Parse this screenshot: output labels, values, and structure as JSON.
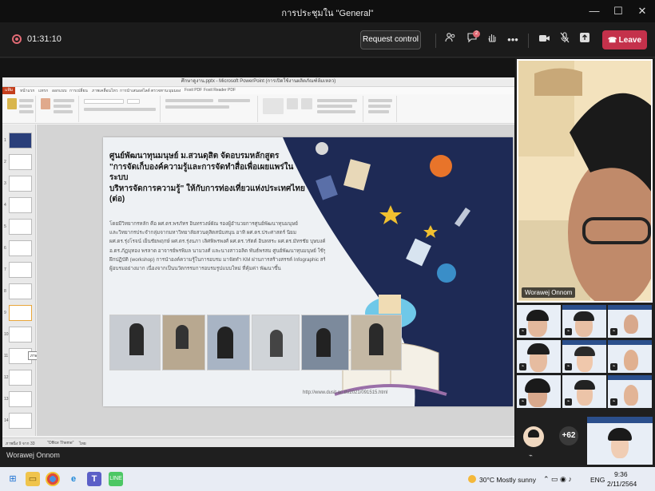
{
  "window": {
    "title": "การประชุมใน \"General\"",
    "minimize": "—",
    "maximize": "☐",
    "close": "✕"
  },
  "toolbar": {
    "timer": "01:31:10",
    "request_control": "Request control",
    "chat_badge": "2",
    "more": "•••",
    "leave": "Leave"
  },
  "powerpoint": {
    "title": "ศึกษาดูงาน.pptx - Microsoft PowerPoint (การเปิดใช้งานผลิตภัณฑ์ล้มเหลว)",
    "file_tab": "แฟ้ม",
    "tabs": [
      "หน้าแรก",
      "แทรก",
      "ออกแบบ",
      "การเปลี่ยน",
      "ภาพเคลื่อนไหว",
      "การนำเสนอสไลด์",
      "ตรวจทาน",
      "มุมมอง",
      "Foxit PDF",
      "Foxit Reader PDF"
    ],
    "tooltip": "ภาพนิ่งสายลาลมย์ ผ.สาวคุลิต วิชเย่...",
    "slide_numbers": [
      "1",
      "2",
      "3",
      "4",
      "5",
      "6",
      "7",
      "8",
      "9",
      "10",
      "11",
      "12",
      "13",
      "14"
    ],
    "status_left": "ภาพนิ่ง 9 จาก 33",
    "status_theme": "\"Office Theme\"",
    "status_lang": "ไทย"
  },
  "slide": {
    "heading_lines": [
      "ศูนย์พัฒนาทุนมนุษย์ ม.สวนดุสิต จัดอบรมหลักสูตร",
      "\"การจัดเก็บองค์ความรู้และการจัดทำสื่อเพื่อเผยแพร่ในระบบ",
      "บริหารจัดการความรู้\" ให้กับการท่องเที่ยวแห่งประเทศไทย",
      "(ต่อ)"
    ],
    "body_lines": [
      "โดยมีวิทยากรหลัก คือ ผศ.ดร.พรภัทร อินทรวงษ์ผัณ รองผู้อำนวยการศูนย์พัฒนาทุนมนุษย์",
      "และวิทยากรประจำกลุ่มจากมหาวิทยาลัยสวนดุสิตสนับสนุน อาทิ ผศ.ดร.ประศาสตร์ นิยม",
      "ผศ.ดร.รุ่งโรจน์ เย็นชัยพฤกษ์ ผศ.ดร.รุ่งนภา เลิศพิพรพงศ์ ผศ.ดร.วรัตต์ อินทสระ ผศ.ดร.มัทรชัย บุษบงค์",
      "อ.ดร.ภัฏมุทอง พรลาด อาจารย์พรพิมล นามวงศ์ และนางสาวอลิต พันธ์พรสม ศูนย์พัฒนาทุนมนุษย์ ใช้รูปแบบการบรรยาย",
      "ฝึกปฏิบัติ (workshop) การนำองค์ความรู้ในการอบรม มาจัดทำ KM ผ่านการสร้างสรรค์ Infographic สร้างความพึงพอใจกับ",
      "ผู้อบรมอย่างมาก เนื่องจากเป็นนวัตกรรมการอบรมรูปแบบใหม่ ที่คุ้มค่า พัฒนาขึ้น"
    ],
    "url": "http://www.dusit.ac.th/2021/091515.html"
  },
  "participants": {
    "speaker_name": "Worawej Onnom",
    "overflow_count": "+62",
    "sharer_name": "Worawej Onnom"
  },
  "taskbar": {
    "weather": "30°C  Mostly sunny",
    "lang": "ENG",
    "time": "9:36",
    "date": "2/11/2564"
  },
  "colors": {
    "leave_red": "#c4314b",
    "teams_dark": "#1f1f1f",
    "ppt_orange": "#c43e1c",
    "slide_navy": "#1e2a55"
  }
}
